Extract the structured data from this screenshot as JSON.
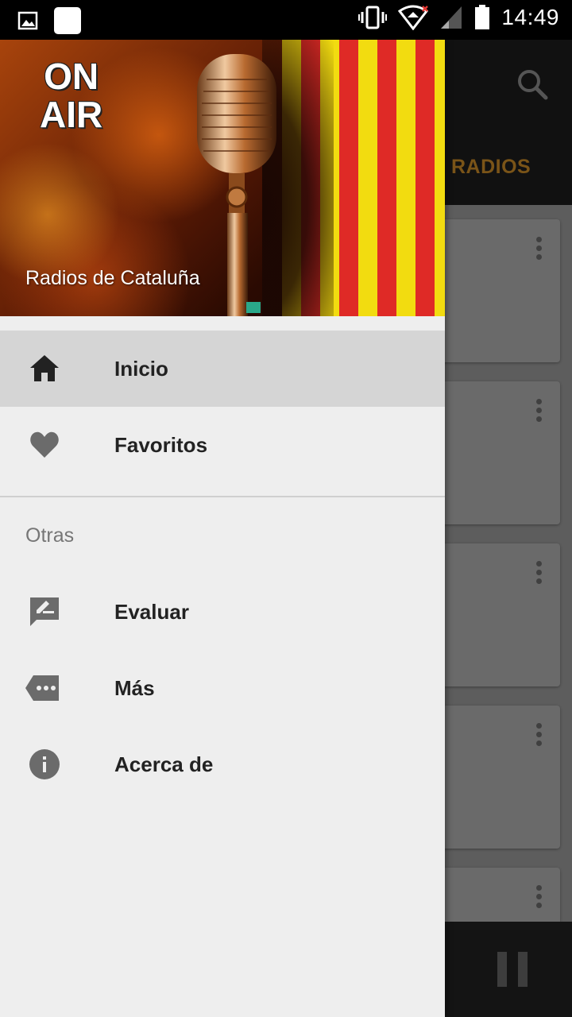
{
  "status_bar": {
    "time": "14:49",
    "icons": [
      "image-icon",
      "app-square-icon",
      "vibrate-icon",
      "wifi-icon",
      "signal-icon",
      "battery-icon"
    ]
  },
  "background_app": {
    "tab_label": "RADIOS",
    "search_icon": "search-icon",
    "card_count": 5,
    "player": {
      "icon": "pause-icon"
    }
  },
  "drawer": {
    "header": {
      "on_air_line1": "ON",
      "on_air_line2": "AIR",
      "title": "Radios de Cataluña"
    },
    "items": [
      {
        "label": "Inicio",
        "icon": "home-icon",
        "active": true
      },
      {
        "label": "Favoritos",
        "icon": "heart-icon",
        "active": false
      }
    ],
    "section_label": "Otras",
    "other_items": [
      {
        "label": "Evaluar",
        "icon": "rate-review-icon"
      },
      {
        "label": "Más",
        "icon": "more-tag-icon"
      },
      {
        "label": "Acerca de",
        "icon": "info-icon"
      }
    ]
  },
  "colors": {
    "drawer_bg": "#eeeeee",
    "active_item_bg": "#d5d5d5",
    "tab_accent": "#7a5418",
    "flag_yellow": "#f2dc10",
    "flag_red": "#df2a26"
  }
}
